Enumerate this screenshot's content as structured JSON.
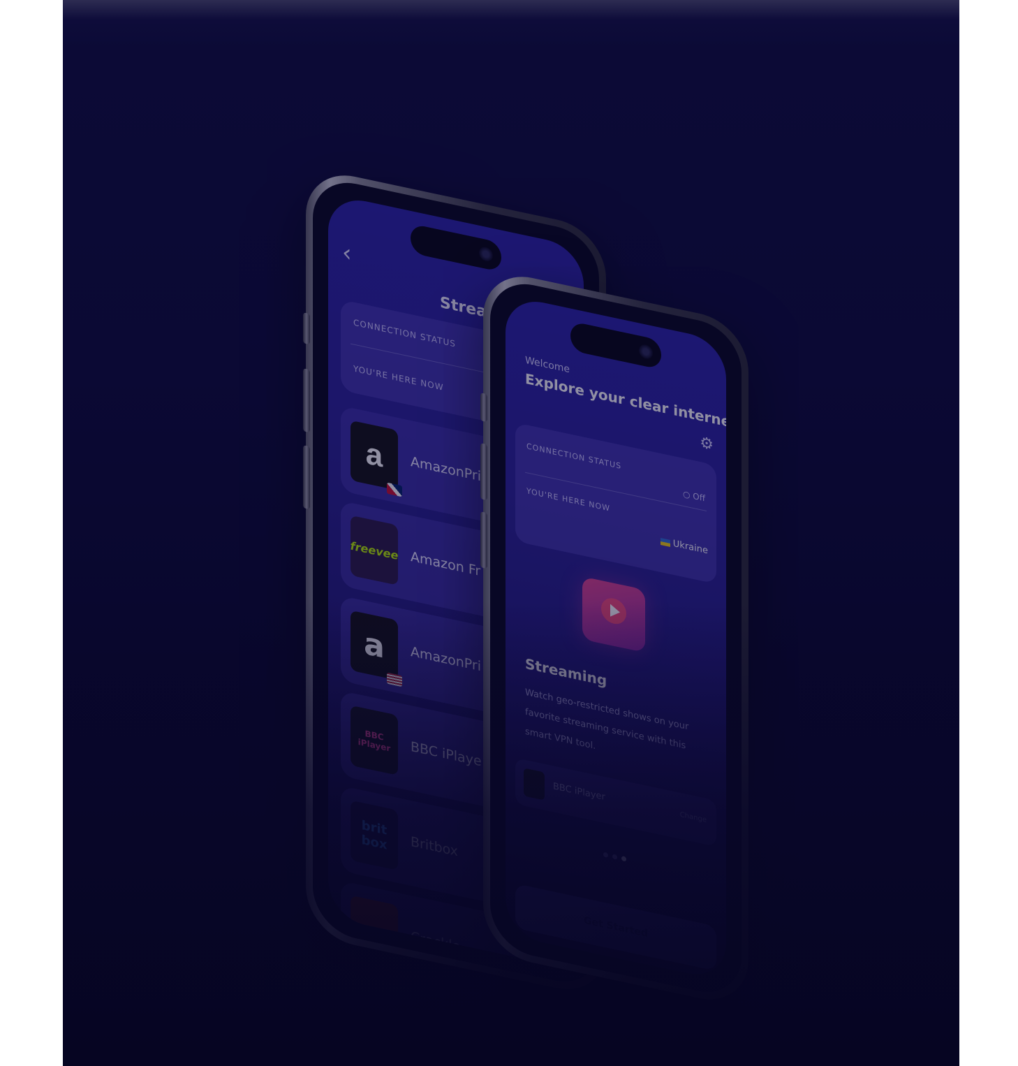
{
  "phone_back": {
    "title": "Streami",
    "connection_status_label": "Connection status",
    "location_label": "You're here now",
    "services": [
      {
        "label": "AmazonPri",
        "logo_text": "a",
        "flag": "uk"
      },
      {
        "label": "Amazon Fr",
        "logo_text": "freevee",
        "flag": ""
      },
      {
        "label": "AmazonPri",
        "logo_text": "a",
        "flag": "us"
      },
      {
        "label": "BBC iPlaye",
        "logo_text": "BBC iPlayer",
        "flag": ""
      },
      {
        "label": "Britbox",
        "logo_text": "brit box",
        "flag": ""
      },
      {
        "label": "Crackle",
        "logo_text": "",
        "flag": ""
      }
    ]
  },
  "phone_front": {
    "welcome": "Welcome",
    "headline": "Explore your clear internet",
    "connection_status_label": "Connection status",
    "connection_value": "Off",
    "location_label": "You're here now",
    "location_value": "Ukraine",
    "feature_title": "Streaming",
    "feature_desc": "Watch geo-restricted shows on your favorite streaming service with this smart VPN tool.",
    "selected_service": "BBC iPlayer",
    "change_label": "Change",
    "cta_label": "Get Started"
  },
  "colors": {
    "background": "#0b0a35",
    "screen": "#2a2296",
    "accent_pink": "#e0448c"
  }
}
